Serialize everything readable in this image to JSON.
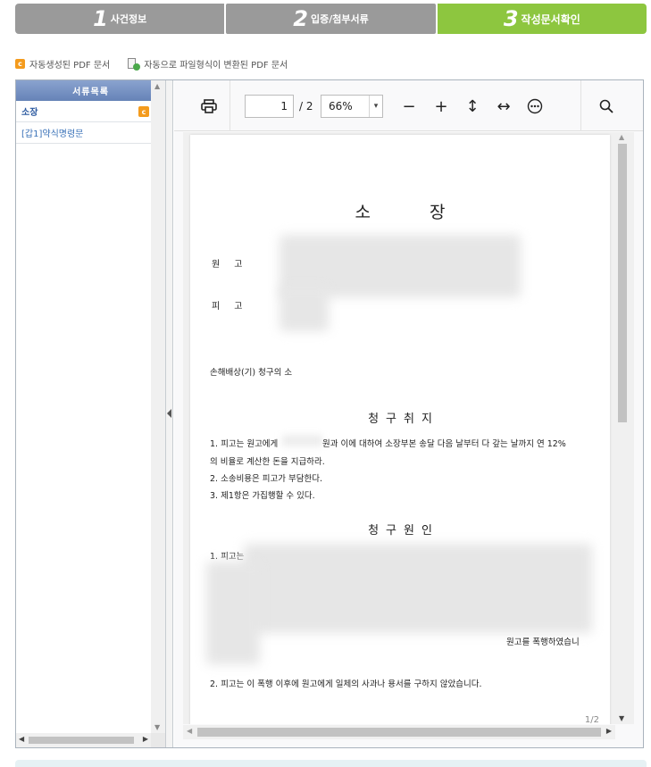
{
  "steps": [
    {
      "num": "1",
      "label": "사건정보"
    },
    {
      "num": "2",
      "label": "입증/첨부서류"
    },
    {
      "num": "3",
      "label": "작성문서확인"
    }
  ],
  "colors": {
    "step_inactive": "#9a9a9a",
    "step_active": "#8dc63f",
    "auto_icon": "#f49b1d",
    "panel_head": "#6f8bbf"
  },
  "legend": {
    "auto_icon_glyph": "c",
    "auto_label": "자동생성된 PDF 문서",
    "converted_label": "자동으로 파일형식이 변환된 PDF 문서"
  },
  "sidebar": {
    "header": "서류목록",
    "items": [
      {
        "label": "소장",
        "icon": "auto-pdf-icon"
      },
      {
        "label": "[갑1]약식명령문"
      }
    ]
  },
  "viewer": {
    "page_current": "1",
    "page_total": "/ 2",
    "zoom": "66%",
    "page_indicator": "1/2"
  },
  "document": {
    "title": "소  장",
    "plaintiff_label": "원고",
    "defendant_label": "피고",
    "case_name": "손해배상(기) 청구의 소",
    "claim_heading": "청구취지",
    "claim_lines": [
      "1. 피고는 원고에게",
      "원과 이에 대하여 소장부본 송달 다음 날부터 다 갚는 날까지 연 12%",
      "의 비율로 계산한 돈을 지급하라.",
      "2. 소송비용은 피고가 부담한다.",
      "3. 제1항은 가집행할 수 있다."
    ],
    "cause_heading": "청구원인",
    "cause_lines": [
      "1. 피고는",
      "원고를 폭행하였습니",
      "2. 피고는 이 폭행 이후에 원고에게 일체의 사과나 용서를 구하지 않았습니다."
    ]
  }
}
